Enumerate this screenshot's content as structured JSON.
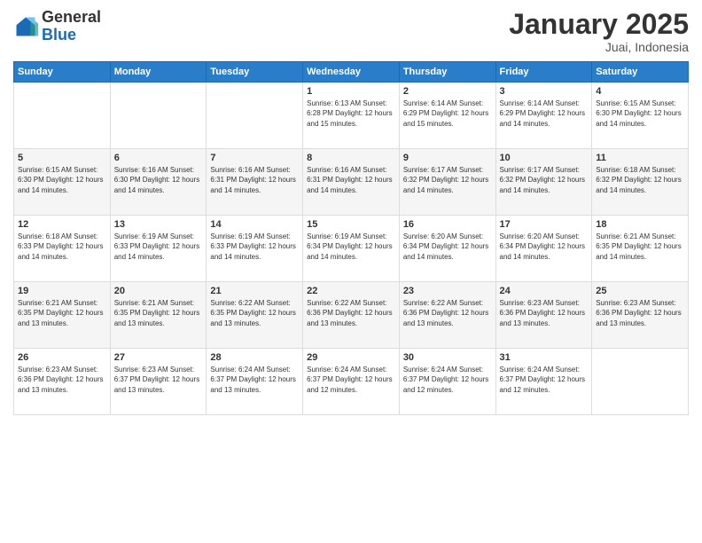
{
  "logo": {
    "general": "General",
    "blue": "Blue"
  },
  "header": {
    "month": "January 2025",
    "location": "Juai, Indonesia"
  },
  "weekdays": [
    "Sunday",
    "Monday",
    "Tuesday",
    "Wednesday",
    "Thursday",
    "Friday",
    "Saturday"
  ],
  "weeks": [
    [
      {
        "day": "",
        "info": ""
      },
      {
        "day": "",
        "info": ""
      },
      {
        "day": "",
        "info": ""
      },
      {
        "day": "1",
        "info": "Sunrise: 6:13 AM\nSunset: 6:28 PM\nDaylight: 12 hours\nand 15 minutes."
      },
      {
        "day": "2",
        "info": "Sunrise: 6:14 AM\nSunset: 6:29 PM\nDaylight: 12 hours\nand 15 minutes."
      },
      {
        "day": "3",
        "info": "Sunrise: 6:14 AM\nSunset: 6:29 PM\nDaylight: 12 hours\nand 14 minutes."
      },
      {
        "day": "4",
        "info": "Sunrise: 6:15 AM\nSunset: 6:30 PM\nDaylight: 12 hours\nand 14 minutes."
      }
    ],
    [
      {
        "day": "5",
        "info": "Sunrise: 6:15 AM\nSunset: 6:30 PM\nDaylight: 12 hours\nand 14 minutes."
      },
      {
        "day": "6",
        "info": "Sunrise: 6:16 AM\nSunset: 6:30 PM\nDaylight: 12 hours\nand 14 minutes."
      },
      {
        "day": "7",
        "info": "Sunrise: 6:16 AM\nSunset: 6:31 PM\nDaylight: 12 hours\nand 14 minutes."
      },
      {
        "day": "8",
        "info": "Sunrise: 6:16 AM\nSunset: 6:31 PM\nDaylight: 12 hours\nand 14 minutes."
      },
      {
        "day": "9",
        "info": "Sunrise: 6:17 AM\nSunset: 6:32 PM\nDaylight: 12 hours\nand 14 minutes."
      },
      {
        "day": "10",
        "info": "Sunrise: 6:17 AM\nSunset: 6:32 PM\nDaylight: 12 hours\nand 14 minutes."
      },
      {
        "day": "11",
        "info": "Sunrise: 6:18 AM\nSunset: 6:32 PM\nDaylight: 12 hours\nand 14 minutes."
      }
    ],
    [
      {
        "day": "12",
        "info": "Sunrise: 6:18 AM\nSunset: 6:33 PM\nDaylight: 12 hours\nand 14 minutes."
      },
      {
        "day": "13",
        "info": "Sunrise: 6:19 AM\nSunset: 6:33 PM\nDaylight: 12 hours\nand 14 minutes."
      },
      {
        "day": "14",
        "info": "Sunrise: 6:19 AM\nSunset: 6:33 PM\nDaylight: 12 hours\nand 14 minutes."
      },
      {
        "day": "15",
        "info": "Sunrise: 6:19 AM\nSunset: 6:34 PM\nDaylight: 12 hours\nand 14 minutes."
      },
      {
        "day": "16",
        "info": "Sunrise: 6:20 AM\nSunset: 6:34 PM\nDaylight: 12 hours\nand 14 minutes."
      },
      {
        "day": "17",
        "info": "Sunrise: 6:20 AM\nSunset: 6:34 PM\nDaylight: 12 hours\nand 14 minutes."
      },
      {
        "day": "18",
        "info": "Sunrise: 6:21 AM\nSunset: 6:35 PM\nDaylight: 12 hours\nand 14 minutes."
      }
    ],
    [
      {
        "day": "19",
        "info": "Sunrise: 6:21 AM\nSunset: 6:35 PM\nDaylight: 12 hours\nand 13 minutes."
      },
      {
        "day": "20",
        "info": "Sunrise: 6:21 AM\nSunset: 6:35 PM\nDaylight: 12 hours\nand 13 minutes."
      },
      {
        "day": "21",
        "info": "Sunrise: 6:22 AM\nSunset: 6:35 PM\nDaylight: 12 hours\nand 13 minutes."
      },
      {
        "day": "22",
        "info": "Sunrise: 6:22 AM\nSunset: 6:36 PM\nDaylight: 12 hours\nand 13 minutes."
      },
      {
        "day": "23",
        "info": "Sunrise: 6:22 AM\nSunset: 6:36 PM\nDaylight: 12 hours\nand 13 minutes."
      },
      {
        "day": "24",
        "info": "Sunrise: 6:23 AM\nSunset: 6:36 PM\nDaylight: 12 hours\nand 13 minutes."
      },
      {
        "day": "25",
        "info": "Sunrise: 6:23 AM\nSunset: 6:36 PM\nDaylight: 12 hours\nand 13 minutes."
      }
    ],
    [
      {
        "day": "26",
        "info": "Sunrise: 6:23 AM\nSunset: 6:36 PM\nDaylight: 12 hours\nand 13 minutes."
      },
      {
        "day": "27",
        "info": "Sunrise: 6:23 AM\nSunset: 6:37 PM\nDaylight: 12 hours\nand 13 minutes."
      },
      {
        "day": "28",
        "info": "Sunrise: 6:24 AM\nSunset: 6:37 PM\nDaylight: 12 hours\nand 13 minutes."
      },
      {
        "day": "29",
        "info": "Sunrise: 6:24 AM\nSunset: 6:37 PM\nDaylight: 12 hours\nand 12 minutes."
      },
      {
        "day": "30",
        "info": "Sunrise: 6:24 AM\nSunset: 6:37 PM\nDaylight: 12 hours\nand 12 minutes."
      },
      {
        "day": "31",
        "info": "Sunrise: 6:24 AM\nSunset: 6:37 PM\nDaylight: 12 hours\nand 12 minutes."
      },
      {
        "day": "",
        "info": ""
      }
    ]
  ]
}
